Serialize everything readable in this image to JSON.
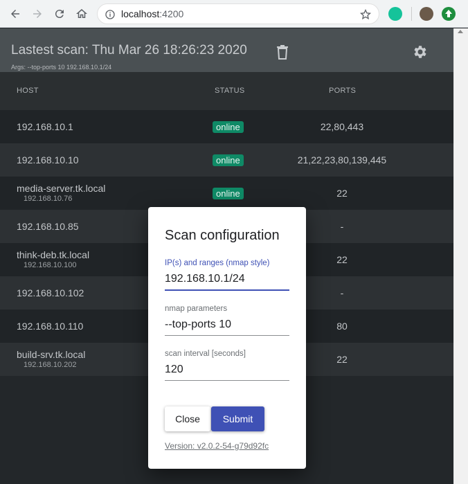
{
  "browser": {
    "url_host": "localhost",
    "url_port": ":4200",
    "icons": {
      "back": "arrow-left-icon",
      "forward": "arrow-right-icon",
      "reload": "reload-icon",
      "home": "home-icon",
      "info": "info-icon",
      "star": "star-icon"
    },
    "colors": {
      "chrome": "#f1f3f4"
    }
  },
  "header": {
    "title": "Lastest scan: Thu Mar 26 18:26:23 2020",
    "args": "Args: --top-ports 10 192.168.10.1/24"
  },
  "table": {
    "columns": [
      "HOST",
      "STATUS",
      "PORTS"
    ],
    "rows": [
      {
        "host": "192.168.10.1",
        "ip": "",
        "status": "online",
        "ports": "22,80,443"
      },
      {
        "host": "192.168.10.10",
        "ip": "",
        "status": "online",
        "ports": "21,22,23,80,139,445"
      },
      {
        "host": "media-server.tk.local",
        "ip": "192.168.10.76",
        "status": "online",
        "ports": "22"
      },
      {
        "host": "192.168.10.85",
        "ip": "",
        "status": "",
        "ports": "-"
      },
      {
        "host": "think-deb.tk.local",
        "ip": "192.168.10.100",
        "status": "",
        "ports": "22"
      },
      {
        "host": "192.168.10.102",
        "ip": "",
        "status": "",
        "ports": "-"
      },
      {
        "host": "192.168.10.110",
        "ip": "",
        "status": "",
        "ports": "80"
      },
      {
        "host": "build-srv.tk.local",
        "ip": "192.168.10.202",
        "status": "",
        "ports": "22"
      }
    ]
  },
  "modal": {
    "title": "Scan configuration",
    "fields": [
      {
        "label": "IP(s) and ranges (nmap style)",
        "value": "192.168.10.1/24"
      },
      {
        "label": "nmap parameters",
        "value": "--top-ports 10"
      },
      {
        "label": "scan interval [seconds]",
        "value": "120"
      }
    ],
    "close_label": "Close",
    "submit_label": "Submit",
    "version": "Version: v2.0.2-54-g79d92fc"
  },
  "colors": {
    "accent": "#3f51b5",
    "online": "#0f8a66",
    "header": "#4a5053",
    "background": "#23272a"
  }
}
